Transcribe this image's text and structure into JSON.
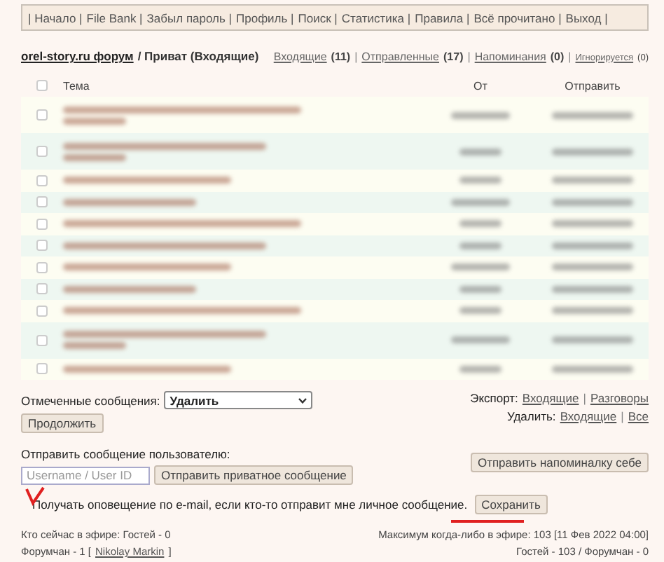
{
  "nav": [
    "| Начало |",
    "File Bank |",
    "Забыл пароль |",
    "Профиль |",
    "Поиск |",
    "Статистика |",
    "Правила |",
    "Всё прочитано |",
    "Выход |"
  ],
  "breadcrumb": {
    "link": "orel-story.ru форум",
    "current": "/ Приват (Входящие)"
  },
  "folders": [
    {
      "label": "Входящие",
      "count": "(11)",
      "small": false,
      "separator": "|"
    },
    {
      "label": "Отправленные",
      "count": "(17)",
      "small": false,
      "separator": "|"
    },
    {
      "label": "Напоминания",
      "count": "(0)",
      "small": false,
      "separator": "|"
    },
    {
      "label": "Игнорируется",
      "count": "(0)",
      "small": true
    }
  ],
  "table": {
    "select_all": {
      "checked": false
    },
    "columns": [
      "Тема",
      "От",
      "Отправить"
    ],
    "rows": [
      {
        "kind": "double",
        "checked": false
      },
      {
        "kind": "double",
        "checked": false
      },
      {
        "kind": "single",
        "checked": false
      },
      {
        "kind": "single",
        "checked": false
      },
      {
        "kind": "single",
        "checked": false
      },
      {
        "kind": "single",
        "checked": false
      },
      {
        "kind": "single",
        "checked": false
      },
      {
        "kind": "single",
        "checked": false
      },
      {
        "kind": "single",
        "checked": false
      },
      {
        "kind": "double",
        "checked": false
      },
      {
        "kind": "single",
        "checked": false
      }
    ]
  },
  "marked": {
    "label": "Отмеченные сообщения:",
    "action": "Удалить",
    "button": "Продолжить"
  },
  "export": {
    "label": "Экспорт:",
    "links": [
      {
        "label": "Входящие",
        "separator": "|"
      },
      {
        "label": "Разговоры"
      }
    ]
  },
  "delete": {
    "label": "Удалить:",
    "links": [
      {
        "label": "Входящие",
        "separator": "|"
      },
      {
        "label": "Все"
      }
    ]
  },
  "send": {
    "label": "Отправить сообщение пользователю:",
    "placeholder": "Username / User ID",
    "button": "Отправить приватное сообщение",
    "reminder_button": "Отправить напоминалку себе"
  },
  "notify": {
    "text": "Получать оповещение по e-mail, если кто-то отправит мне личное сообщение.",
    "button": "Сохранить"
  },
  "footer": {
    "online": "Кто сейчас в эфире: Гостей - 0",
    "members_prefix": "Форумчан - 1 [",
    "member": "Nikolay Markin",
    "members_suffix": "]",
    "max": "Максимум когда-либо в эфире: 103 [11 Фев 2022 04:00]",
    "max_detail": "Гостей - 103 / Форумчан - 0"
  }
}
